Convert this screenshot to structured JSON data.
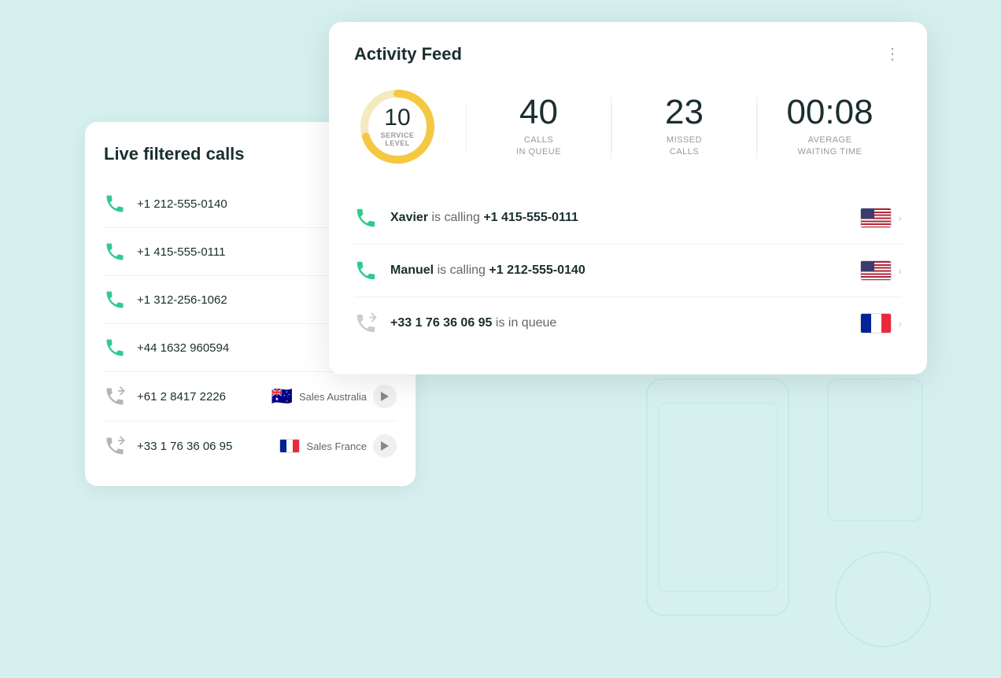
{
  "background": {
    "color": "#d6f0ef"
  },
  "liveCallsCard": {
    "title": "Live filtered calls",
    "calls": [
      {
        "id": 1,
        "number": "+1 212-555-0140",
        "type": "inbound",
        "flag": null,
        "tag": null
      },
      {
        "id": 2,
        "number": "+1 415-555-0111",
        "type": "inbound",
        "flag": null,
        "tag": null
      },
      {
        "id": 3,
        "number": "+1 312-256-1062",
        "type": "inbound",
        "flag": null,
        "tag": null
      },
      {
        "id": 4,
        "number": "+44 1632 960594",
        "type": "inbound",
        "flag": null,
        "tag": null
      },
      {
        "id": 5,
        "number": "+61 2 8417 2226",
        "type": "outbound",
        "flag": "au",
        "tag": "Sales Australia"
      },
      {
        "id": 6,
        "number": "+33 1 76 36 06 95",
        "type": "outbound",
        "flag": "fr",
        "tag": "Sales France"
      }
    ]
  },
  "activityFeed": {
    "title": "Activity Feed",
    "moreIcon": "⋮",
    "stats": {
      "donut": {
        "value": 10,
        "label": "SERVICE\nLEVEL",
        "percent": 70,
        "trackColor": "#f5e9c0",
        "fillColor": "#f5c842"
      },
      "callsInQueue": {
        "value": "40",
        "label": "CALLS\nIN QUEUE"
      },
      "missedCalls": {
        "value": "23",
        "label": "MISSED\nCALLS"
      },
      "avgWaitTime": {
        "value": "00:08",
        "label": "AVERAGE\nWAITING TIME"
      }
    },
    "activities": [
      {
        "id": 1,
        "callerName": "Xavier",
        "status": "is calling",
        "number": "+1 415-555-0111",
        "type": "active",
        "flag": "us"
      },
      {
        "id": 2,
        "callerName": "Manuel",
        "status": "is calling",
        "number": "+1 212-555-0140",
        "type": "active",
        "flag": "us"
      },
      {
        "id": 3,
        "callerName": "",
        "status": "is in queue",
        "number": "+33 1 76 36 06 95",
        "type": "queue",
        "flag": "fr"
      }
    ]
  }
}
